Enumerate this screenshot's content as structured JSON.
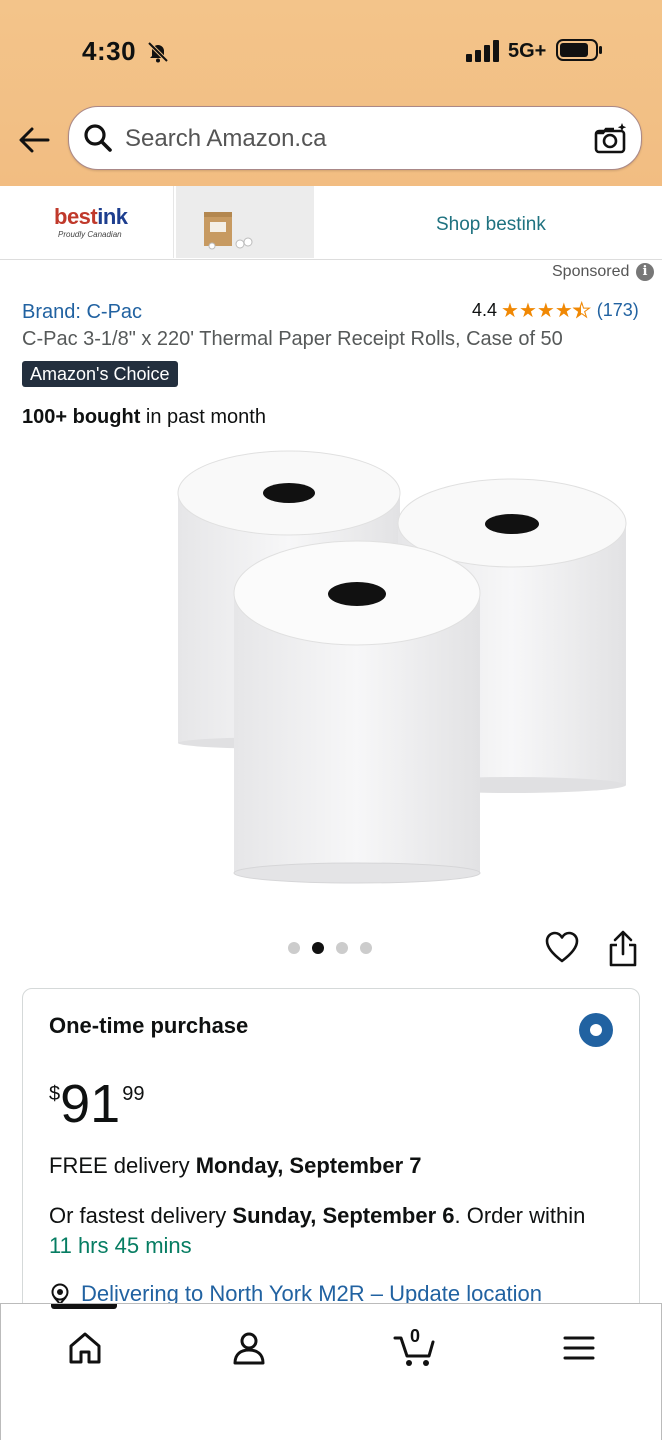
{
  "status_bar": {
    "time": "4:30",
    "network": "5G+"
  },
  "search": {
    "placeholder": "Search Amazon.ca"
  },
  "banner": {
    "brand_name": "bestink",
    "brand_tagline": "Proudly Canadian",
    "shop_label": "Shop bestink"
  },
  "sponsored": {
    "label": "Sponsored"
  },
  "product": {
    "brand": "Brand: C-Pac",
    "rating": "4.4",
    "rating_stars": 4.4,
    "rating_count": "(173)",
    "title": "C-Pac 3-1/8\" x 220' Thermal Paper Receipt Rolls, Case of 50",
    "badge": "Amazon's Choice",
    "bought_bold": "100+ bought",
    "bought_rest": " in past month"
  },
  "carousel": {
    "total": 4,
    "active_index": 1
  },
  "purchase": {
    "heading": "One-time purchase",
    "currency": "$",
    "price_whole": "91",
    "price_fraction": "99",
    "delivery_prefix": "FREE delivery ",
    "delivery_date": "Monday, September 7",
    "fastest_prefix": "Or fastest delivery ",
    "fastest_date": "Sunday, September 6",
    "fastest_mid": ". Order within ",
    "fastest_time": "11 hrs 45 mins",
    "location": "Delivering to North York M2R – Update location"
  },
  "bottom_nav": {
    "items": [
      "home-icon",
      "account-icon",
      "cart-icon",
      "menu-icon"
    ],
    "cart_count": "0"
  },
  "colors": {
    "accent_link": "#2162a1",
    "star": "#f08804",
    "header_bg": "#f3c48a",
    "badge_bg": "#232f3e",
    "green": "#067d62"
  }
}
